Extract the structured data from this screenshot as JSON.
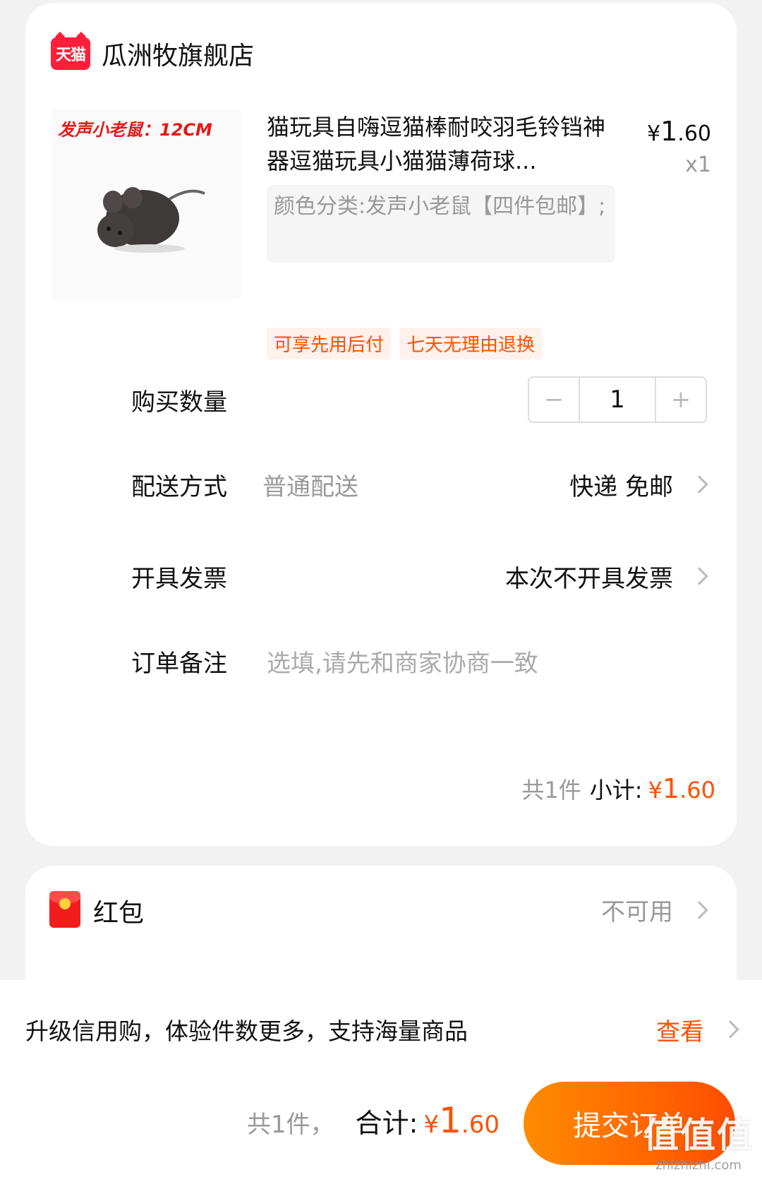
{
  "shop": {
    "logo_text": "天猫",
    "name": "瓜洲牧旗舰店"
  },
  "product": {
    "image_caption": "发声小老鼠：12CM",
    "title": "猫玩具自嗨逗猫棒耐咬羽毛铃铛神器逗猫玩具小猫猫薄荷球...",
    "price_symbol": "¥",
    "price_int": "1",
    "price_dec": ".60",
    "qty": "x1",
    "sku": "颜色分类:发声小老鼠【四件包邮】;",
    "tags": [
      "可享先用后付",
      "七天无理由退换"
    ]
  },
  "quantity": {
    "label": "购买数量",
    "minus": "−",
    "value": "1",
    "plus": "+"
  },
  "delivery": {
    "label": "配送方式",
    "method": "普通配送",
    "value": "快递 免邮"
  },
  "invoice": {
    "label": "开具发票",
    "value": "本次不开具发票"
  },
  "note": {
    "label": "订单备注",
    "placeholder": "选填,请先和商家协商一致"
  },
  "subtotal": {
    "count": "共1件",
    "label": "小计:",
    "symbol": "¥",
    "int": "1",
    "dec": ".60"
  },
  "red_packet": {
    "label": "红包",
    "value": "不可用"
  },
  "promo": {
    "text": "升级信用购，体验件数更多，支持海量商品",
    "link": "查看"
  },
  "footer": {
    "count": "共1件，",
    "label": "合计:",
    "symbol": "¥",
    "int": "1",
    "dec": ".60",
    "submit": "提交订单"
  },
  "watermark": {
    "main": "值值值",
    "sub": "zhizhizhi.com"
  },
  "colors": {
    "accent": "#ff5000",
    "tmall_red": "#ff1f3a",
    "button_start": "#ff8c00",
    "button_end": "#ff4d00"
  }
}
